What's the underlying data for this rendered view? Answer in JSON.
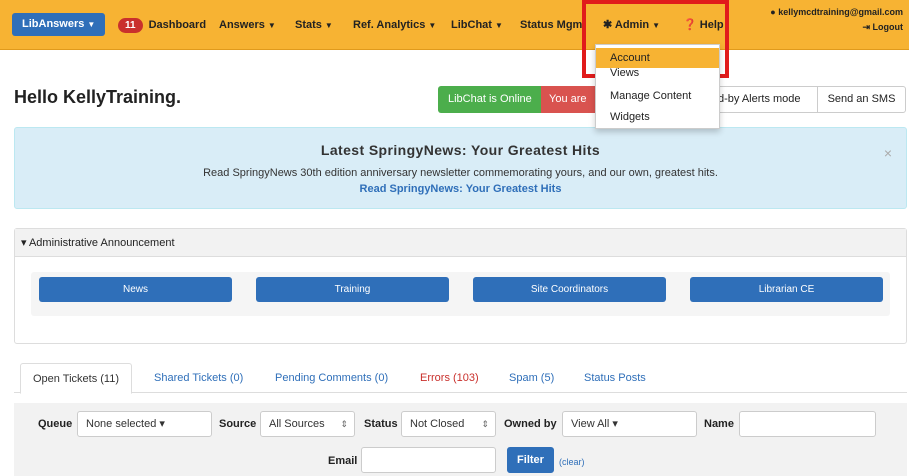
{
  "nav": {
    "brand": "LibAnswers",
    "dashboard_count": "11",
    "dashboard": "Dashboard",
    "answers": "Answers",
    "stats": "Stats",
    "ref_analytics": "Ref. Analytics",
    "libchat": "LibChat",
    "status_mgmt": "Status Mgmt",
    "admin": "Admin",
    "help": "Help",
    "user_email": "kellymcdtraining@gmail.com",
    "logout": "Logout"
  },
  "admin_menu": [
    "Account",
    "Views",
    "Manage Content",
    "Widgets"
  ],
  "hello": "Hello KellyTraining.",
  "status_buttons": {
    "online": "LibChat is Online",
    "you_are": "You are",
    "dropby": "d-by Alerts mode",
    "sms": "Send an SMS"
  },
  "alert": {
    "title": "Latest SpringyNews: Your Greatest Hits",
    "body": "Read SpringyNews 30th edition anniversary newsletter commemorating yours, and our own, greatest hits.",
    "link": "Read SpringyNews: Your Greatest Hits",
    "close": "×"
  },
  "announcement": {
    "heading": "▾ Administrative Announcement",
    "buttons": [
      "News",
      "Training",
      "Site Coordinators",
      "Librarian CE"
    ]
  },
  "tabs": [
    {
      "label": "Open Tickets (11)",
      "color": "#333333"
    },
    {
      "label": "Shared Tickets (0)",
      "color": "#2f6fb9"
    },
    {
      "label": "Pending Comments (0)",
      "color": "#2f6fb9"
    },
    {
      "label": "Errors (103)",
      "color": "#c9302c"
    },
    {
      "label": "Spam (5)",
      "color": "#2f6fb9"
    },
    {
      "label": "Status Posts",
      "color": "#2f6fb9"
    }
  ],
  "filter": {
    "queue_label": "Queue",
    "queue_value": "None selected ▾",
    "source_label": "Source",
    "source_value": "All Sources",
    "status_label": "Status",
    "status_value": "Not Closed",
    "owned_label": "Owned by",
    "owned_value": "View All ▾",
    "name_label": "Name",
    "email_label": "Email",
    "filter_button": "Filter",
    "clear": "(clear)"
  }
}
